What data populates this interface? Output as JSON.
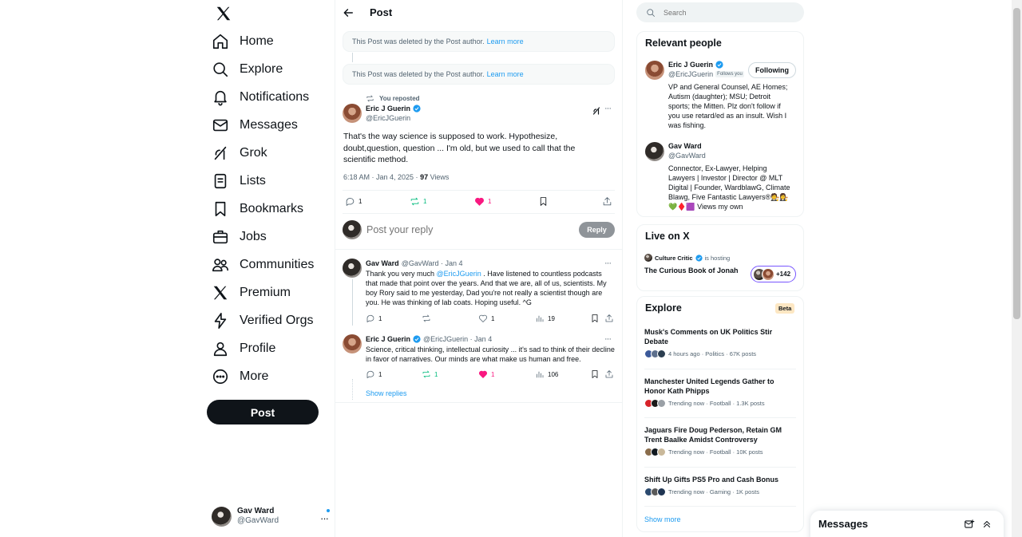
{
  "nav": {
    "items": [
      {
        "label": "Home",
        "icon": "home-icon"
      },
      {
        "label": "Explore",
        "icon": "search-icon"
      },
      {
        "label": "Notifications",
        "icon": "bell-icon"
      },
      {
        "label": "Messages",
        "icon": "envelope-icon"
      },
      {
        "label": "Grok",
        "icon": "grok-icon"
      },
      {
        "label": "Lists",
        "icon": "list-icon"
      },
      {
        "label": "Bookmarks",
        "icon": "bookmark-icon"
      },
      {
        "label": "Jobs",
        "icon": "briefcase-icon"
      },
      {
        "label": "Communities",
        "icon": "people-icon"
      },
      {
        "label": "Premium",
        "icon": "x-logo-icon"
      },
      {
        "label": "Verified Orgs",
        "icon": "lightning-icon"
      },
      {
        "label": "Profile",
        "icon": "person-icon"
      },
      {
        "label": "More",
        "icon": "more-circle-icon"
      }
    ],
    "post_button": "Post",
    "account": {
      "name": "Gav Ward",
      "handle": "@GavWard"
    }
  },
  "main": {
    "header_title": "Post",
    "deleted_notice": "This Post was deleted by the Post author.",
    "learn_more": "Learn more",
    "repost_label": "You reposted",
    "focal": {
      "name": "Eric J Guerin",
      "handle": "@EricJGuerin",
      "text": "That's the way science is supposed to work.  Hypothesize, doubt,question, question ...  I'm old, but we used to call that the scientific method.",
      "time": "6:18 AM · Jan 4, 2025 · ",
      "views_count": "97",
      "views_label": " Views",
      "replies": "1",
      "reposts": "1",
      "likes": "1"
    },
    "reply_placeholder": "Post your reply",
    "reply_button": "Reply",
    "replies": [
      {
        "name": "Gav Ward",
        "meta": "@GavWard · Jan 4",
        "text_before": "Thank you very much ",
        "mention": "@EricJGuerin",
        "text_after": " . Have listened to countless podcasts that made that point over the years. And that we are, all of us, scientists. My boy Rory said to me yesterday, Dad you're not really a scientist though are you. He was thinking of lab coats. Hoping useful. ^G",
        "replies": "1",
        "likes": "1",
        "views": "19"
      },
      {
        "name": "Eric J Guerin",
        "meta": "@EricJGuerin · Jan 4",
        "text": "Science, critical thinking, intellectual curiosity ... it's sad to think of their decline in favor of narratives.  Our minds are what make us human and free.",
        "replies": "1",
        "reposts": "1",
        "likes": "1",
        "views": "106"
      }
    ],
    "show_replies": "Show replies"
  },
  "right": {
    "search_placeholder": "Search",
    "relevant_title": "Relevant people",
    "people": [
      {
        "name": "Eric J Guerin",
        "handle": "@EricJGuerin",
        "follows_you": "Follows you",
        "button": "Following",
        "bio": "VP and General Counsel, AE Homes; Autism (daughter); MSU; Detroit sports; the Mitten. Plz don't follow if you use retard/ed as an insult. Wish I was fishing."
      },
      {
        "name": "Gav Ward",
        "handle": "@GavWard",
        "bio": "Connector, Ex-Lawyer, Helping Lawyers | Investor | Director @ MLT Digital | Founder, WardblawG, Climate Blawg, Five Fantastic Lawyers®🧑‍⚖️👩‍⚖️ 💚♦️🟪 Views my own"
      }
    ],
    "live_title": "Live on X",
    "live": {
      "host": "Culture Critic",
      "hosting": "is hosting",
      "title": "The Curious Book of Jonah",
      "count": "+142"
    },
    "explore_title": "Explore",
    "beta": "Beta",
    "trends": [
      {
        "title": "Musk's Comments on UK Politics Stir Debate",
        "meta": "4 hours ago · Politics · 67K posts"
      },
      {
        "title": "Manchester United Legends Gather to Honor Kath Phipps",
        "meta": "Trending now · Football · 1.3K posts"
      },
      {
        "title": "Jaguars Fire Doug Pederson, Retain GM Trent Baalke Amidst Controversy",
        "meta": "Trending now · Football · 10K posts"
      },
      {
        "title": "Shift Up Gifts PS5 Pro and Cash Bonus",
        "meta": "Trending now · Gaming · 1K posts"
      }
    ],
    "show_more": "Show more"
  },
  "messages_drawer": {
    "title": "Messages"
  },
  "colors": {
    "accent": "#1d9bf0",
    "like": "#f91880",
    "repost": "#00ba7c",
    "text": "#0f1419",
    "muted": "#536471"
  }
}
